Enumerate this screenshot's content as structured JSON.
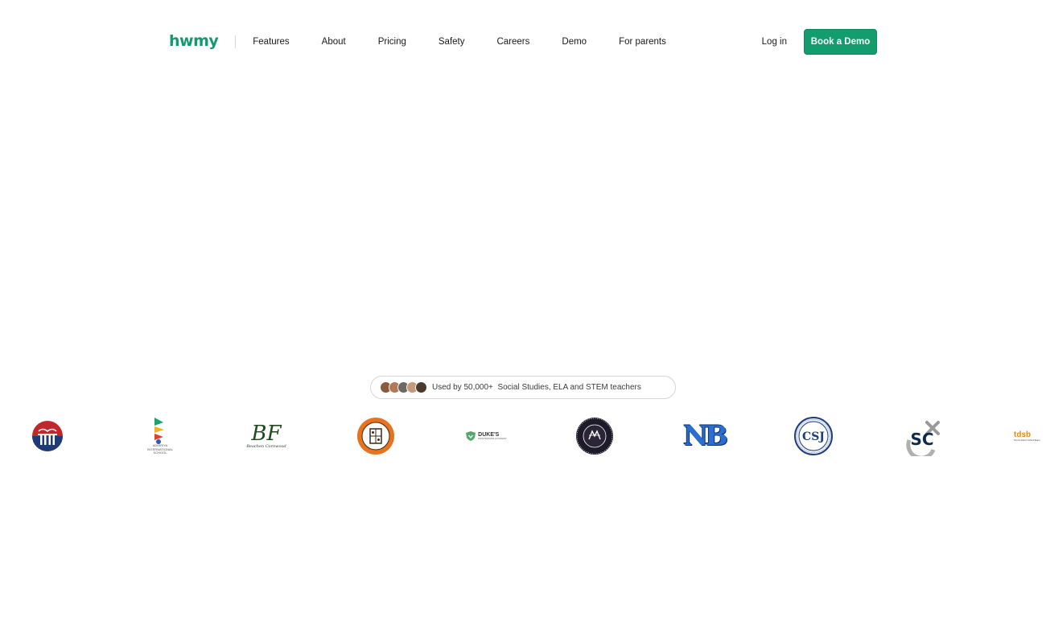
{
  "nav": {
    "logo": "hwmy",
    "links": [
      "Features",
      "About",
      "Pricing",
      "Safety",
      "Careers",
      "Demo",
      "For parents"
    ],
    "login": "Log in",
    "cta": "Book a Demo"
  },
  "badge": {
    "text": "Used by 50,000+  Social Studies, ELA and STEM teachers"
  },
  "logos": {
    "adhiriya": "ADHIRIYA INTERNATIONAL SCHOOL",
    "bf": "BF",
    "bf_sub": "Beachen Cornwood",
    "dukes": "DUKE'S",
    "dukes_sub": "MONTESSORI ACADEMY",
    "nb": "NB",
    "sc": "SC",
    "tdsb": "tdsb",
    "tdsb_sub": "Toronto District School Board",
    "csj": "CSJ"
  },
  "colors": {
    "brand_green": "#139c6d"
  }
}
